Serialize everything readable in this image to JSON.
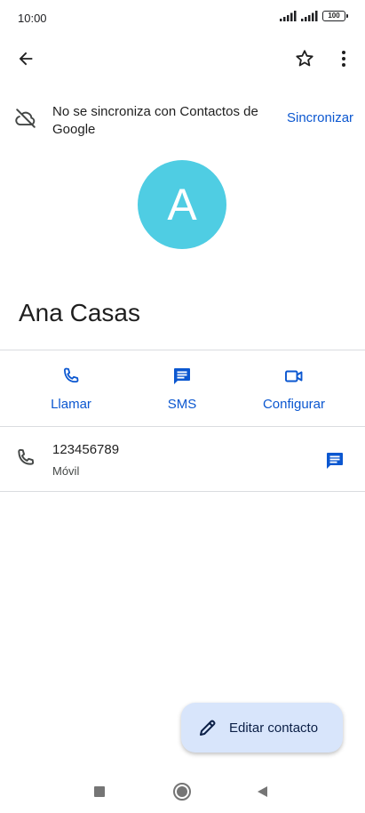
{
  "status_bar": {
    "time": "10:00",
    "battery": "100"
  },
  "app_bar": {
    "back_icon": "arrow-back-icon",
    "star_icon": "star-outline-icon",
    "more_icon": "more-vert-icon"
  },
  "sync_notice": {
    "text": "No se sincroniza con Contactos de Google",
    "action": "Sincronizar",
    "icon": "cloud-off-icon"
  },
  "contact": {
    "avatar_letter": "A",
    "avatar_color": "#4fcde3",
    "name": "Ana Casas"
  },
  "actions": [
    {
      "label": "Llamar",
      "icon": "phone-icon"
    },
    {
      "label": "SMS",
      "icon": "message-icon"
    },
    {
      "label": "Configurar",
      "icon": "video-icon"
    }
  ],
  "phone_entry": {
    "number": "123456789",
    "type": "Móvil"
  },
  "fab": {
    "label": "Editar contacto",
    "icon": "pencil-icon"
  },
  "colors": {
    "accent": "#0b57d0",
    "fab_bg": "#d8e5fb",
    "divider": "#dadce0"
  }
}
